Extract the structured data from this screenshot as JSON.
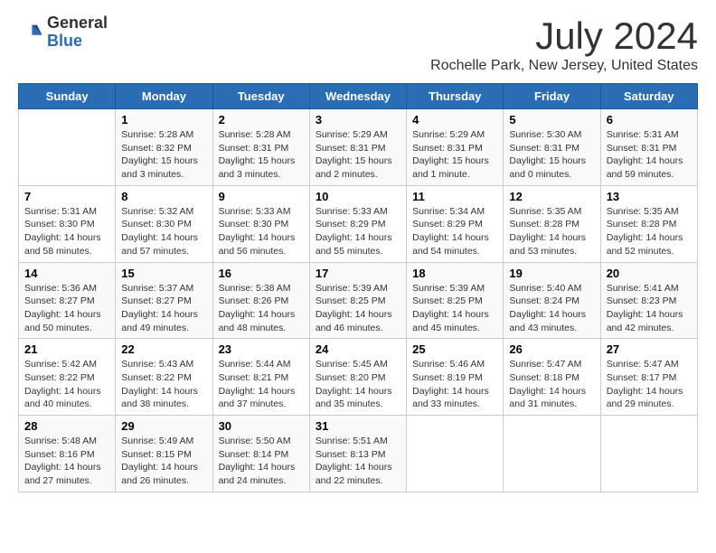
{
  "logo": {
    "general": "General",
    "blue": "Blue"
  },
  "title": "July 2024",
  "subtitle": "Rochelle Park, New Jersey, United States",
  "days_of_week": [
    "Sunday",
    "Monday",
    "Tuesday",
    "Wednesday",
    "Thursday",
    "Friday",
    "Saturday"
  ],
  "weeks": [
    [
      {
        "day": "",
        "info": ""
      },
      {
        "day": "1",
        "info": "Sunrise: 5:28 AM\nSunset: 8:32 PM\nDaylight: 15 hours\nand 3 minutes."
      },
      {
        "day": "2",
        "info": "Sunrise: 5:28 AM\nSunset: 8:31 PM\nDaylight: 15 hours\nand 3 minutes."
      },
      {
        "day": "3",
        "info": "Sunrise: 5:29 AM\nSunset: 8:31 PM\nDaylight: 15 hours\nand 2 minutes."
      },
      {
        "day": "4",
        "info": "Sunrise: 5:29 AM\nSunset: 8:31 PM\nDaylight: 15 hours\nand 1 minute."
      },
      {
        "day": "5",
        "info": "Sunrise: 5:30 AM\nSunset: 8:31 PM\nDaylight: 15 hours\nand 0 minutes."
      },
      {
        "day": "6",
        "info": "Sunrise: 5:31 AM\nSunset: 8:31 PM\nDaylight: 14 hours\nand 59 minutes."
      }
    ],
    [
      {
        "day": "7",
        "info": "Sunrise: 5:31 AM\nSunset: 8:30 PM\nDaylight: 14 hours\nand 58 minutes."
      },
      {
        "day": "8",
        "info": "Sunrise: 5:32 AM\nSunset: 8:30 PM\nDaylight: 14 hours\nand 57 minutes."
      },
      {
        "day": "9",
        "info": "Sunrise: 5:33 AM\nSunset: 8:30 PM\nDaylight: 14 hours\nand 56 minutes."
      },
      {
        "day": "10",
        "info": "Sunrise: 5:33 AM\nSunset: 8:29 PM\nDaylight: 14 hours\nand 55 minutes."
      },
      {
        "day": "11",
        "info": "Sunrise: 5:34 AM\nSunset: 8:29 PM\nDaylight: 14 hours\nand 54 minutes."
      },
      {
        "day": "12",
        "info": "Sunrise: 5:35 AM\nSunset: 8:28 PM\nDaylight: 14 hours\nand 53 minutes."
      },
      {
        "day": "13",
        "info": "Sunrise: 5:35 AM\nSunset: 8:28 PM\nDaylight: 14 hours\nand 52 minutes."
      }
    ],
    [
      {
        "day": "14",
        "info": "Sunrise: 5:36 AM\nSunset: 8:27 PM\nDaylight: 14 hours\nand 50 minutes."
      },
      {
        "day": "15",
        "info": "Sunrise: 5:37 AM\nSunset: 8:27 PM\nDaylight: 14 hours\nand 49 minutes."
      },
      {
        "day": "16",
        "info": "Sunrise: 5:38 AM\nSunset: 8:26 PM\nDaylight: 14 hours\nand 48 minutes."
      },
      {
        "day": "17",
        "info": "Sunrise: 5:39 AM\nSunset: 8:25 PM\nDaylight: 14 hours\nand 46 minutes."
      },
      {
        "day": "18",
        "info": "Sunrise: 5:39 AM\nSunset: 8:25 PM\nDaylight: 14 hours\nand 45 minutes."
      },
      {
        "day": "19",
        "info": "Sunrise: 5:40 AM\nSunset: 8:24 PM\nDaylight: 14 hours\nand 43 minutes."
      },
      {
        "day": "20",
        "info": "Sunrise: 5:41 AM\nSunset: 8:23 PM\nDaylight: 14 hours\nand 42 minutes."
      }
    ],
    [
      {
        "day": "21",
        "info": "Sunrise: 5:42 AM\nSunset: 8:22 PM\nDaylight: 14 hours\nand 40 minutes."
      },
      {
        "day": "22",
        "info": "Sunrise: 5:43 AM\nSunset: 8:22 PM\nDaylight: 14 hours\nand 38 minutes."
      },
      {
        "day": "23",
        "info": "Sunrise: 5:44 AM\nSunset: 8:21 PM\nDaylight: 14 hours\nand 37 minutes."
      },
      {
        "day": "24",
        "info": "Sunrise: 5:45 AM\nSunset: 8:20 PM\nDaylight: 14 hours\nand 35 minutes."
      },
      {
        "day": "25",
        "info": "Sunrise: 5:46 AM\nSunset: 8:19 PM\nDaylight: 14 hours\nand 33 minutes."
      },
      {
        "day": "26",
        "info": "Sunrise: 5:47 AM\nSunset: 8:18 PM\nDaylight: 14 hours\nand 31 minutes."
      },
      {
        "day": "27",
        "info": "Sunrise: 5:47 AM\nSunset: 8:17 PM\nDaylight: 14 hours\nand 29 minutes."
      }
    ],
    [
      {
        "day": "28",
        "info": "Sunrise: 5:48 AM\nSunset: 8:16 PM\nDaylight: 14 hours\nand 27 minutes."
      },
      {
        "day": "29",
        "info": "Sunrise: 5:49 AM\nSunset: 8:15 PM\nDaylight: 14 hours\nand 26 minutes."
      },
      {
        "day": "30",
        "info": "Sunrise: 5:50 AM\nSunset: 8:14 PM\nDaylight: 14 hours\nand 24 minutes."
      },
      {
        "day": "31",
        "info": "Sunrise: 5:51 AM\nSunset: 8:13 PM\nDaylight: 14 hours\nand 22 minutes."
      },
      {
        "day": "",
        "info": ""
      },
      {
        "day": "",
        "info": ""
      },
      {
        "day": "",
        "info": ""
      }
    ]
  ]
}
